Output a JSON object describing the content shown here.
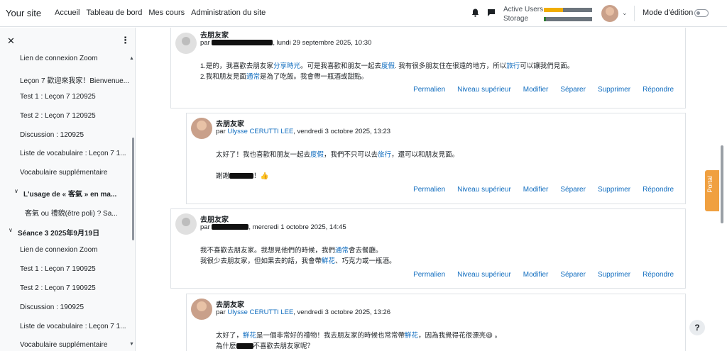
{
  "brand": "Your site",
  "nav": [
    "Accueil",
    "Tableau de bord",
    "Mes cours",
    "Administration du site"
  ],
  "header": {
    "active_users_label": "Active Users",
    "storage_label": "Storage",
    "edit_mode_label": "Mode d'édition",
    "active_users_fraction": 0.4,
    "storage_fraction": 0.05,
    "active_users_color": "#f0ad00",
    "storage_color": "#2e7d32"
  },
  "drawer": {
    "items": [
      "Lien de connexion Zoom",
      "Leçon 7 歡迎來我家！Bienvenue...",
      "Test 1 : Leçon 7 120925",
      "Test 2 : Leçon 7 120925",
      "Discussion : 120925",
      "Liste de vocabulaire : Leçon 7 1...",
      "Vocabulaire supplémentaire",
      "L'usage de « 客氣 » en ma...",
      "客氣 ou 禮貌(être poli) ? Sa...",
      "Séance 3 2025年9月19日",
      "Lien de connexion Zoom",
      "Test 1 : Leçon 7 190925",
      "Test 2 : Leçon 7 190925",
      "Discussion : 190925",
      "Liste de vocabulaire : Leçon 7 1...",
      "Vocabulaire supplémentaire"
    ]
  },
  "actions": [
    "Permalien",
    "Niveau supérieur",
    "Modifier",
    "Séparer",
    "Supprimer",
    "Répondre"
  ],
  "posts": [
    {
      "title": "去朋友家",
      "by": "par",
      "date": ", lundi 29 septembre 2025, 10:30",
      "l1a": "1.是的，我喜歡去朋友家",
      "l1b": "分享時光",
      "l1c": "。可是我喜歡和朋友一起去",
      "l1d": "度假",
      "l1e": ". 我有很多朋友住在很遠的地方，所以",
      "l1f": "旅行",
      "l1g": "可以讓我們見面。",
      "l2a": "2.我和朋友見面",
      "l2b": "通常",
      "l2c": "是為了吃飯。我會帶一瓶酒或甜點。"
    },
    {
      "title": "去朋友家",
      "by": "par",
      "author": "Ulysse CERUTTI LEE",
      "date": ", vendredi 3 octobre 2025, 13:23",
      "l1a": "太好了！我也喜歡和朋友一起去",
      "l1b": "度假",
      "l1c": "，我們不只可以去",
      "l1d": "旅行",
      "l1e": "，還可以和朋友見面。",
      "l2a": "謝謝",
      "l2b": "！👍"
    },
    {
      "title": "去朋友家",
      "by": "par",
      "date": ", mercredi 1 octobre 2025, 14:45",
      "l1a": "我不喜歡去朋友家。我想見他們的時候，我們",
      "l1b": "通常",
      "l1c": "會去餐廳。",
      "l2a": "我很少去朋友家，但如果去的話，我會帶",
      "l2b": "鮮花",
      "l2c": "、巧克力或一瓶酒。"
    },
    {
      "title": "去朋友家",
      "by": "par",
      "author": "Ulysse CERUTTI LEE",
      "date": ", vendredi 3 octobre 2025, 13:26",
      "l1a": "太好了，",
      "l1b": "鮮花",
      "l1c": "是一個非常好的禮物！我去朋友家的時候也常常帶",
      "l1d": "鮮花",
      "l1e": "，因為我覺得花很漂亮😆 。",
      "l2a": "為什麼",
      "l2b": "不喜歡去朋友家呢？"
    }
  ],
  "portal_label": "Portal",
  "help_label": "?"
}
